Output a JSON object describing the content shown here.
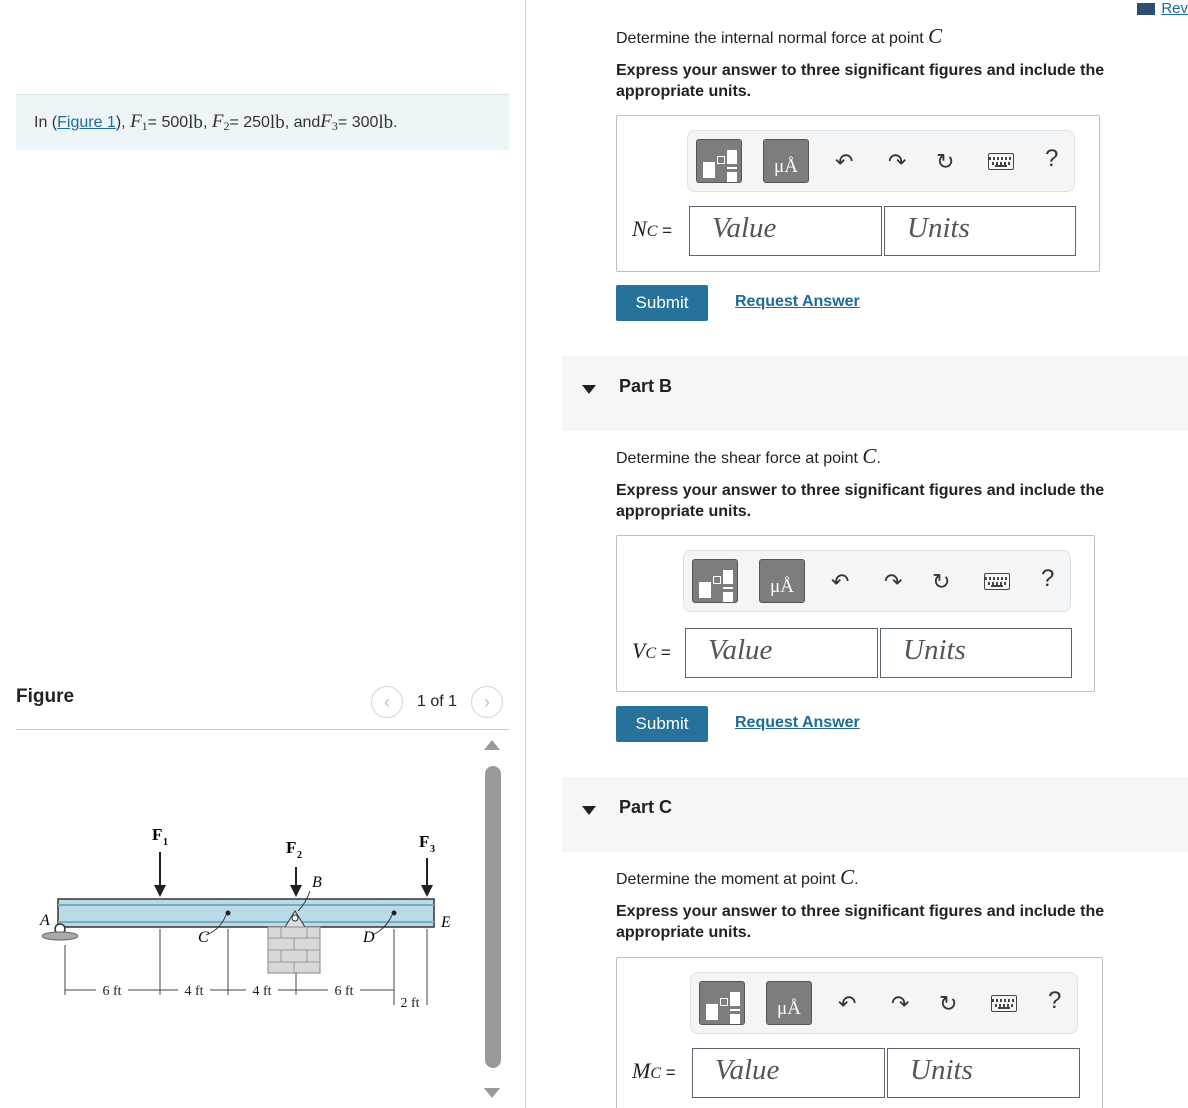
{
  "intro": {
    "prefix": "In (",
    "figure_link": "Figure 1",
    "suffix": "),",
    "f1_var": "F",
    "f1_sub": "1",
    "f1_val": " = 500 ",
    "f2_var": "F",
    "f2_sub": "2",
    "f2_val": " = 250 ",
    "f3_var": "F",
    "f3_sub": "3",
    "f3_val": " = 300 ",
    "unit": "lb",
    "and": ", and "
  },
  "figure_panel": {
    "title": "Figure",
    "pager_text": "1 of 1",
    "prev_icon": "chevron-left-icon",
    "next_icon": "chevron-right-icon"
  },
  "figure": {
    "labels": {
      "F1": "F",
      "F1_sub": "1",
      "F2": "F",
      "F2_sub": "2",
      "F3": "F",
      "F3_sub": "3",
      "A": "A",
      "B": "B",
      "C": "C",
      "D": "D",
      "E": "E"
    },
    "dims": [
      "6 ft",
      "4 ft",
      "4 ft",
      "6 ft",
      "2 ft"
    ]
  },
  "review": {
    "label": "Rev"
  },
  "parts": [
    {
      "header": "",
      "question_prefix": "Determine the internal normal force at point ",
      "question_point": "C",
      "question_suffix": "",
      "instructions": "Express your answer to three significant figures and include the appropriate units.",
      "var": "N",
      "var_sub": "C",
      "eq": " =",
      "value_placeholder": "Value",
      "units_placeholder": "Units",
      "submit": "Submit",
      "request": "Request Answer"
    },
    {
      "header": "Part B",
      "question_prefix": "Determine the shear force at point ",
      "question_point": "C",
      "question_suffix": ".",
      "instructions": "Express your answer to three significant figures and include the appropriate units.",
      "var": "V",
      "var_sub": "C",
      "eq": " =",
      "value_placeholder": "Value",
      "units_placeholder": "Units",
      "submit": "Submit",
      "request": "Request Answer"
    },
    {
      "header": "Part C",
      "question_prefix": "Determine the moment at point ",
      "question_point": "C",
      "question_suffix": ".",
      "instructions": "Express your answer to three significant figures and include the appropriate units.",
      "var": "M",
      "var_sub": "C",
      "eq": " =",
      "value_placeholder": "Value",
      "units_placeholder": "Units"
    }
  ],
  "toolbar": {
    "template_icon": "fraction-template-icon",
    "units_button": "μÅ",
    "undo_icon": "undo-icon",
    "redo_icon": "redo-icon",
    "reset_icon": "reset-icon",
    "keyboard_icon": "keyboard-icon",
    "help": "?"
  }
}
